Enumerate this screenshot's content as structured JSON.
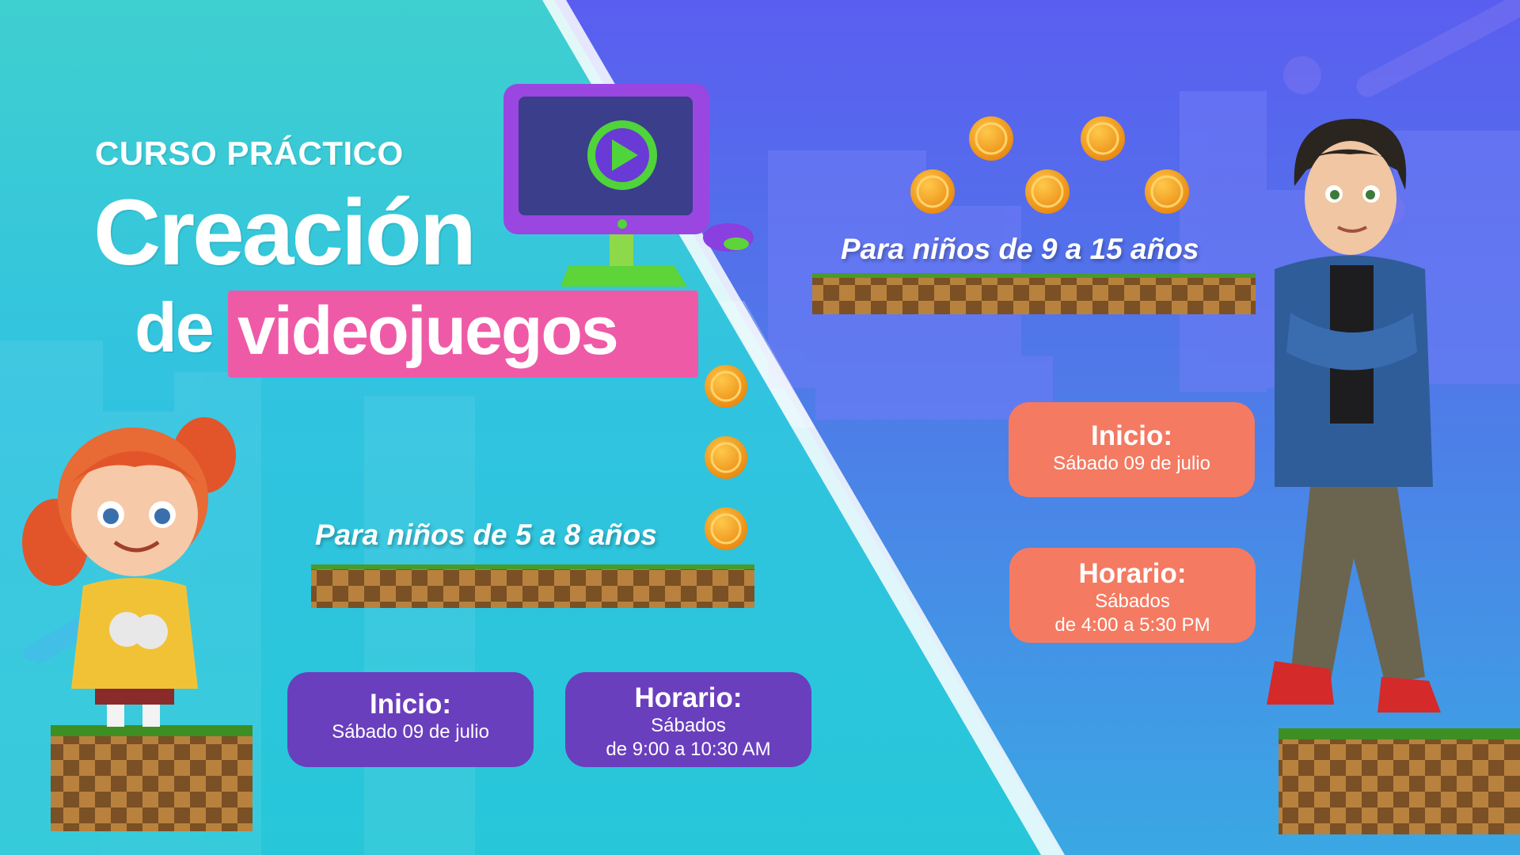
{
  "header": {
    "eyebrow": "CURSO PRÁCTICO",
    "title_line1": "Creación",
    "title_line2_prefix": "de",
    "title_line2_highlight": "videojuegos"
  },
  "groups": {
    "young": {
      "age_label": "Para niños de 5 a 8 años",
      "start_title": "Inicio:",
      "start_date": "Sábado 09 de julio",
      "schedule_title": "Horario:",
      "schedule_days": "Sábados",
      "schedule_time": "de 9:00 a 10:30 AM"
    },
    "older": {
      "age_label": "Para niños de 9 a 15 años",
      "start_title": "Inicio:",
      "start_date": "Sábado 09 de julio",
      "schedule_title": "Horario:",
      "schedule_days": "Sábados",
      "schedule_time": "de 4:00 a 5:30 PM"
    }
  },
  "colors": {
    "left_bg": "#31c3e0",
    "right_bg": "#5a5ef0",
    "highlight_pink": "#ef5aa6",
    "card_purple": "#6a3fbd",
    "card_coral": "#f47a62",
    "coin_orange": "#f5a020"
  },
  "icons": [
    "monitor-play-icon",
    "mouse-icon",
    "coin-icon"
  ]
}
